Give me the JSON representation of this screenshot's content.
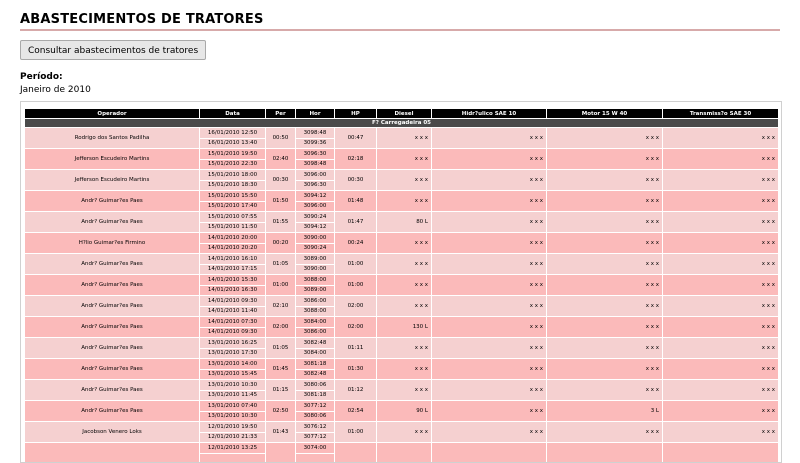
{
  "page": {
    "title": "ABASTECIMENTOS DE TRATORES",
    "button_label": "Consultar abastecimentos de tratores",
    "period_label": "Período:",
    "period_value": "Janeiro de 2010"
  },
  "table": {
    "headers": [
      "Operador",
      "Data",
      "Per",
      "Hor",
      "HP",
      "Diesel",
      "Hidr?ulico SAE 10",
      "Motor 15 W 40",
      "Transmiss?o SAE 30"
    ],
    "group": "F? Carregadeira 05",
    "rows": [
      {
        "operator": "Rodrigo dos Santos Padilha",
        "date1": "16/01/2010 12:50",
        "date2": "16/01/2010 13:40",
        "per": "00:50",
        "hor1": "3098:48",
        "hor2": "3099:36",
        "hp": "00:47",
        "diesel": "x x x",
        "hidr": "x x x",
        "motor": "x x x",
        "trans": "x x x",
        "c": "a"
      },
      {
        "operator": "Jefferson Escudeiro Martins",
        "date1": "15/01/2010 19:50",
        "date2": "15/01/2010 22:30",
        "per": "02:40",
        "hor1": "3096:30",
        "hor2": "3098:48",
        "hp": "02:18",
        "diesel": "x x x",
        "hidr": "x x x",
        "motor": "x x x",
        "trans": "x x x",
        "c": "b"
      },
      {
        "operator": "Jefferson Escudeiro Martins",
        "date1": "15/01/2010 18:00",
        "date2": "15/01/2010 18:30",
        "per": "00:30",
        "hor1": "3096:00",
        "hor2": "3096:30",
        "hp": "00:30",
        "diesel": "x x x",
        "hidr": "x x x",
        "motor": "x x x",
        "trans": "x x x",
        "c": "a"
      },
      {
        "operator": "Andr? Guimar?es Paes",
        "date1": "15/01/2010 15:50",
        "date2": "15/01/2010 17:40",
        "per": "01:50",
        "hor1": "3094:12",
        "hor2": "3096:00",
        "hp": "01:48",
        "diesel": "x x x",
        "hidr": "x x x",
        "motor": "x x x",
        "trans": "x x x",
        "c": "b"
      },
      {
        "operator": "Andr? Guimar?es Paes",
        "date1": "15/01/2010 07:55",
        "date2": "15/01/2010 11:50",
        "per": "01:55",
        "hor1": "3090:24",
        "hor2": "3094:12",
        "hp": "01:47",
        "diesel": "80 L",
        "hidr": "x x x",
        "motor": "x x x",
        "trans": "x x x",
        "c": "a"
      },
      {
        "operator": "H?lio Guimar?es Firmino",
        "date1": "14/01/2010 20:00",
        "date2": "14/01/2010 20:20",
        "per": "00:20",
        "hor1": "3090:00",
        "hor2": "3090:24",
        "hp": "00:24",
        "diesel": "x x x",
        "hidr": "x x x",
        "motor": "x x x",
        "trans": "x x x",
        "c": "b"
      },
      {
        "operator": "Andr? Guimar?es Paes",
        "date1": "14/01/2010 16:10",
        "date2": "14/01/2010 17:15",
        "per": "01:05",
        "hor1": "3089:00",
        "hor2": "3090:00",
        "hp": "01:00",
        "diesel": "x x x",
        "hidr": "x x x",
        "motor": "x x x",
        "trans": "x x x",
        "c": "a"
      },
      {
        "operator": "Andr? Guimar?es Paes",
        "date1": "14/01/2010 15:30",
        "date2": "14/01/2010 16:30",
        "per": "01:00",
        "hor1": "3088:00",
        "hor2": "3089:00",
        "hp": "01:00",
        "diesel": "x x x",
        "hidr": "x x x",
        "motor": "x x x",
        "trans": "x x x",
        "c": "b"
      },
      {
        "operator": "Andr? Guimar?es Paes",
        "date1": "14/01/2010 09:30",
        "date2": "14/01/2010 11:40",
        "per": "02:10",
        "hor1": "3086:00",
        "hor2": "3088:00",
        "hp": "02:00",
        "diesel": "x x x",
        "hidr": "x x x",
        "motor": "x x x",
        "trans": "x x x",
        "c": "a"
      },
      {
        "operator": "Andr? Guimar?es Paes",
        "date1": "14/01/2010 07:30",
        "date2": "14/01/2010 09:30",
        "per": "02:00",
        "hor1": "3084:00",
        "hor2": "3086:00",
        "hp": "02:00",
        "diesel": "130 L",
        "hidr": "x x x",
        "motor": "x x x",
        "trans": "x x x",
        "c": "b"
      },
      {
        "operator": "Andr? Guimar?es Paes",
        "date1": "13/01/2010 16:25",
        "date2": "13/01/2010 17:30",
        "per": "01:05",
        "hor1": "3082:48",
        "hor2": "3084:00",
        "hp": "01:11",
        "diesel": "x x x",
        "hidr": "x x x",
        "motor": "x x x",
        "trans": "x x x",
        "c": "a"
      },
      {
        "operator": "Andr? Guimar?es Paes",
        "date1": "13/01/2010 14:00",
        "date2": "13/01/2010 15:45",
        "per": "01:45",
        "hor1": "3081:18",
        "hor2": "3082:48",
        "hp": "01:30",
        "diesel": "x x x",
        "hidr": "x x x",
        "motor": "x x x",
        "trans": "x x x",
        "c": "b"
      },
      {
        "operator": "Andr? Guimar?es Paes",
        "date1": "13/01/2010 10:30",
        "date2": "13/01/2010 11:45",
        "per": "01:15",
        "hor1": "3080:06",
        "hor2": "3081:18",
        "hp": "01:12",
        "diesel": "x x x",
        "hidr": "x x x",
        "motor": "x x x",
        "trans": "x x x",
        "c": "a"
      },
      {
        "operator": "Andr? Guimar?es Paes",
        "date1": "13/01/2010 07:40",
        "date2": "13/01/2010 10:30",
        "per": "02:50",
        "hor1": "3077:12",
        "hor2": "3080:06",
        "hp": "02:54",
        "diesel": "90 L",
        "hidr": "x x x",
        "motor": "3 L",
        "trans": "x x x",
        "c": "b"
      },
      {
        "operator": "Jacobson Venero Loks",
        "date1": "12/01/2010 19:50",
        "date2": "12/01/2010 21:33",
        "per": "01:43",
        "hor1": "3076:12",
        "hor2": "3077:12",
        "hp": "01:00",
        "diesel": "x x x",
        "hidr": "x x x",
        "motor": "x x x",
        "trans": "x x x",
        "c": "a"
      },
      {
        "operator": "",
        "date1": "12/01/2010 13:25",
        "date2": "",
        "per": "",
        "hor1": "3074:00",
        "hor2": "",
        "hp": "",
        "diesel": "",
        "hidr": "",
        "motor": "",
        "trans": "",
        "c": "b"
      }
    ]
  }
}
